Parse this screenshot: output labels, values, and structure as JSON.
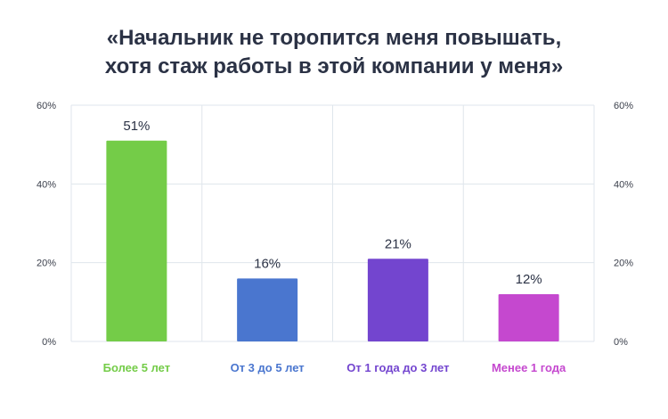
{
  "chart_data": {
    "type": "bar",
    "title_lines": [
      "«Начальник не торопится меня повышать,",
      "хотя стаж работы в этой компании у меня»"
    ],
    "categories": [
      "Более 5 лет",
      "От 3 до 5 лет",
      "От 1 года до 3 лет",
      "Менее 1 года"
    ],
    "values": [
      51,
      16,
      21,
      12
    ],
    "value_labels": [
      "51%",
      "16%",
      "21%",
      "12%"
    ],
    "colors": [
      "#74cc48",
      "#4a76cf",
      "#7345cf",
      "#c548cf"
    ],
    "y_ticks": [
      {
        "value": 0,
        "label": "0%"
      },
      {
        "value": 20,
        "label": "20%"
      },
      {
        "value": 40,
        "label": "40%"
      },
      {
        "value": 60,
        "label": "60%"
      }
    ],
    "ylim": [
      0,
      60
    ],
    "grid": true,
    "secondary_axis_right": true
  }
}
